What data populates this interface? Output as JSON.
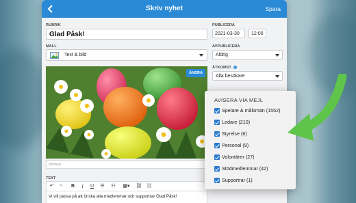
{
  "topbar": {
    "title": "Skriv nyhet",
    "save_label": "Spara"
  },
  "main": {
    "headline_label": "RUBRIK",
    "headline_value": "Glad Påsk!",
    "template_label": "MALL",
    "template_value": "Text & bild",
    "change_image_label": "ÄNDRA",
    "caption_placeholder": "Bildtext",
    "text_label": "TEXT",
    "editor_text": "Vi vill passa på att önska alla medlemmar och supportrar Glad Påsk!"
  },
  "sidebar": {
    "publish_label": "PUBLICERA",
    "publish_date": "2021-03-30",
    "publish_time": "12:00",
    "unpublish_label": "AVPUBLICERA",
    "unpublish_value": "Aldrig",
    "access_label": "ÅTKOMST",
    "access_value": "Alla besökare"
  },
  "notify": {
    "title": "AVISERA VIA MEJL",
    "items": [
      {
        "label": "Spelare & målsmän (1552)",
        "checked": true
      },
      {
        "label": "Ledare (210)",
        "checked": true
      },
      {
        "label": "Styrelse (6)",
        "checked": true
      },
      {
        "label": "Personal (9)",
        "checked": true
      },
      {
        "label": "Volontärer (27)",
        "checked": true
      },
      {
        "label": "Stödmedlemmar (42)",
        "checked": true
      },
      {
        "label": "Supportrar (1)",
        "checked": true
      }
    ]
  },
  "colors": {
    "accent": "#2a8ad6",
    "arrow": "#5fc44a"
  }
}
